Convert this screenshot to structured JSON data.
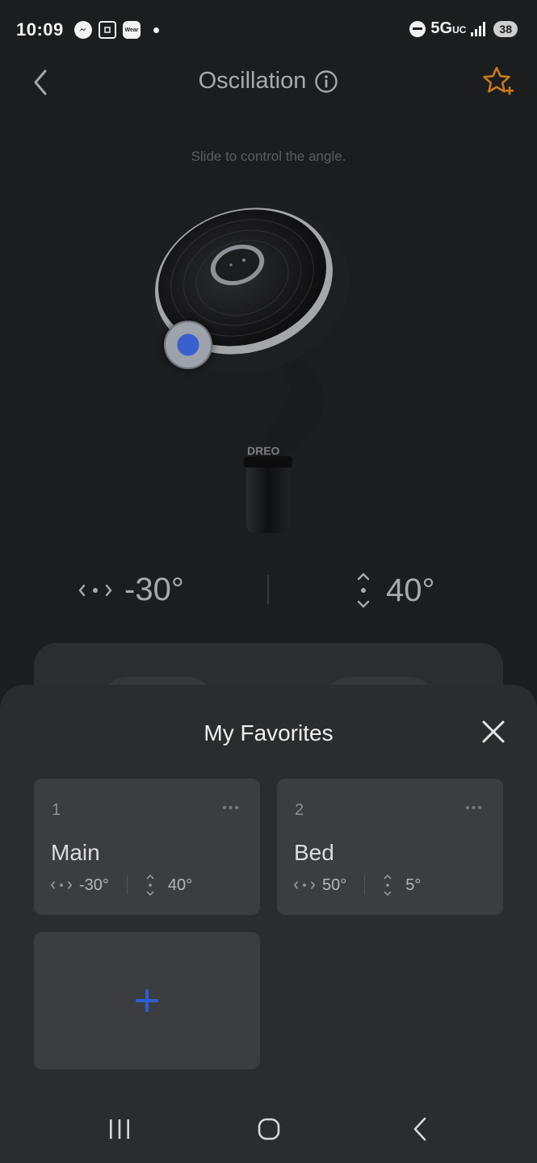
{
  "status_bar": {
    "time": "10:09",
    "wear_label": "Wear",
    "network": "5G",
    "network_suffix": "UC",
    "battery": "38"
  },
  "header": {
    "title": "Oscillation",
    "back_icon": "chevron-left-icon",
    "info_icon": "info-icon",
    "favorite_icon": "star-plus-icon",
    "accent_color": "#c8781e"
  },
  "hint": "Slide to control the angle.",
  "fan": {
    "brand_text": "DREO"
  },
  "angles": {
    "horizontal": "-30°",
    "vertical": "40°"
  },
  "favorites_sheet": {
    "title": "My Favorites",
    "close_icon": "close-icon",
    "items": [
      {
        "number": "1",
        "name": "Main",
        "horizontal": "-30°",
        "vertical": "40°",
        "more": "•••"
      },
      {
        "number": "2",
        "name": "Bed",
        "horizontal": "50°",
        "vertical": "5°",
        "more": "•••"
      }
    ],
    "add_icon": "plus-icon",
    "add_color": "#2f5fd0"
  },
  "nav_bar": {
    "recents_icon": "recents-icon",
    "home_icon": "home-icon",
    "back_icon": "back-icon"
  }
}
